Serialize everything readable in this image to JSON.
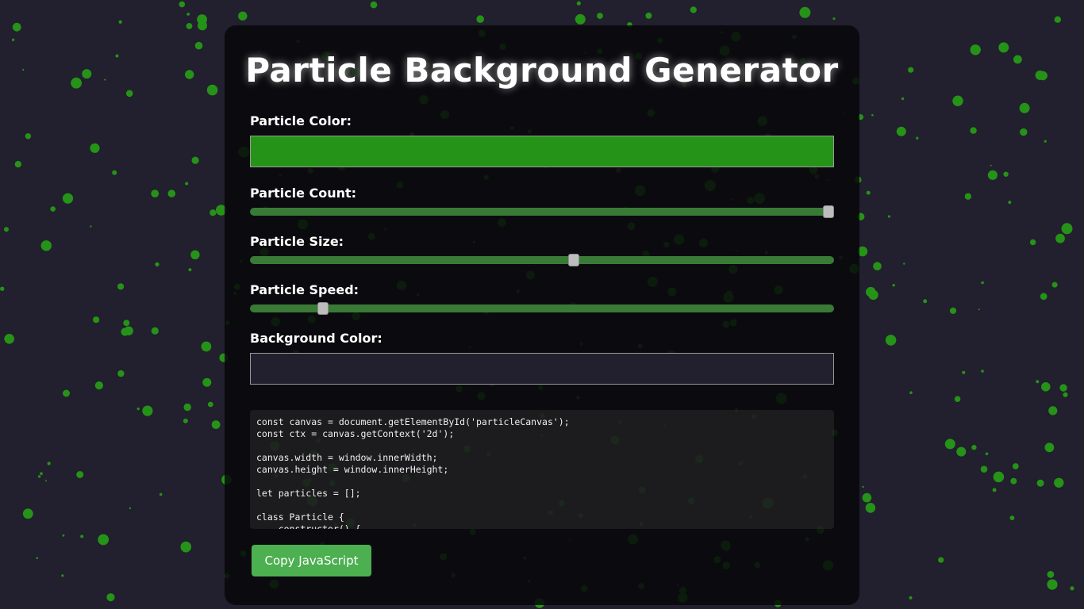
{
  "app": {
    "title": "Particle Background Generator"
  },
  "controls": {
    "particle_color": {
      "label": "Particle Color:",
      "value": "#259317"
    },
    "particle_count": {
      "label": "Particle Count:",
      "fraction": 1.0
    },
    "particle_size": {
      "label": "Particle Size:",
      "fraction": 0.555
    },
    "particle_speed": {
      "label": "Particle Speed:",
      "fraction": 0.118
    },
    "background_color": {
      "label": "Background Color:",
      "value": "#221f2e"
    }
  },
  "code": {
    "lines": [
      "const canvas = document.getElementById('particleCanvas');",
      "const ctx = canvas.getContext('2d');",
      "",
      "canvas.width = window.innerWidth;",
      "canvas.height = window.innerHeight;",
      "",
      "let particles = [];",
      "",
      "class Particle {",
      "    constructor() {"
    ]
  },
  "actions": {
    "copy_label": "Copy JavaScript"
  },
  "colors": {
    "particle": "#259317",
    "background": "#221f2e",
    "slider_track": "#3a7a37",
    "button": "#4caf50"
  }
}
